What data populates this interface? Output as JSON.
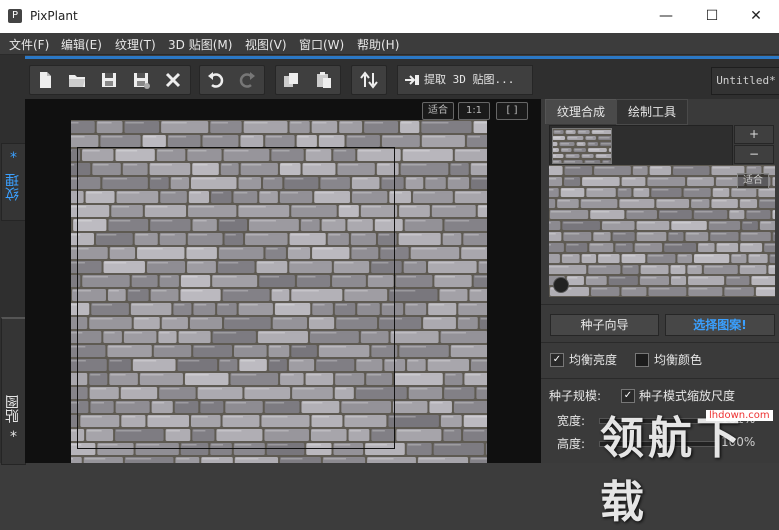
{
  "window": {
    "app_icon": "P",
    "title": "PixPlant",
    "minimize": "—",
    "maximize": "☐",
    "close": "✕"
  },
  "menu": [
    "文件(F)",
    "编辑(E)",
    "纹理(T)",
    "3D 贴图(M)",
    "视图(V)",
    "窗口(W)",
    "帮助(H)"
  ],
  "side_tabs": {
    "texture": "纹理",
    "texture_marker": "*",
    "map": "贴图",
    "map_marker": "*"
  },
  "toolbar": {
    "icons": [
      "new-file-icon",
      "open-folder-icon",
      "save-icon",
      "save-as-icon",
      "close-x-icon",
      "undo-icon",
      "redo-icon",
      "copy-icon",
      "paste-icon",
      "swap-icon"
    ],
    "extract_label": "提取 3D 贴图...",
    "document_name": "Untitled*"
  },
  "canvas": {
    "zoom_fit": "适合",
    "zoom_1_1": "1:1",
    "zoom_frame": "[ ]"
  },
  "panel": {
    "tabs": [
      "纹理合成",
      "绘制工具"
    ],
    "active_tab": 0,
    "plus": "+",
    "minus": "−",
    "preview_fit": "适合",
    "seed_wizard": "种子向导",
    "choose_pattern": "选择图案!",
    "balance_brightness": "均衡亮度",
    "balance_brightness_checked": true,
    "balance_color": "均衡颜色",
    "balance_color_checked": false,
    "seed_scale_label": "种子规模:",
    "seed_scale_mode": "种子模式缩放尺度",
    "seed_scale_mode_checked": true,
    "width_label": "宽度:",
    "width_value": "101%",
    "height_label": "高度:",
    "height_value": "100%"
  },
  "watermark": {
    "text": "领航下载",
    "url": "lhdown.com"
  },
  "colors": {
    "accent": "#2b78c5",
    "choose_pattern_text": "#3aa0ff",
    "panel_bg": "#3a3a3a",
    "canvas_bg": "#101010"
  }
}
